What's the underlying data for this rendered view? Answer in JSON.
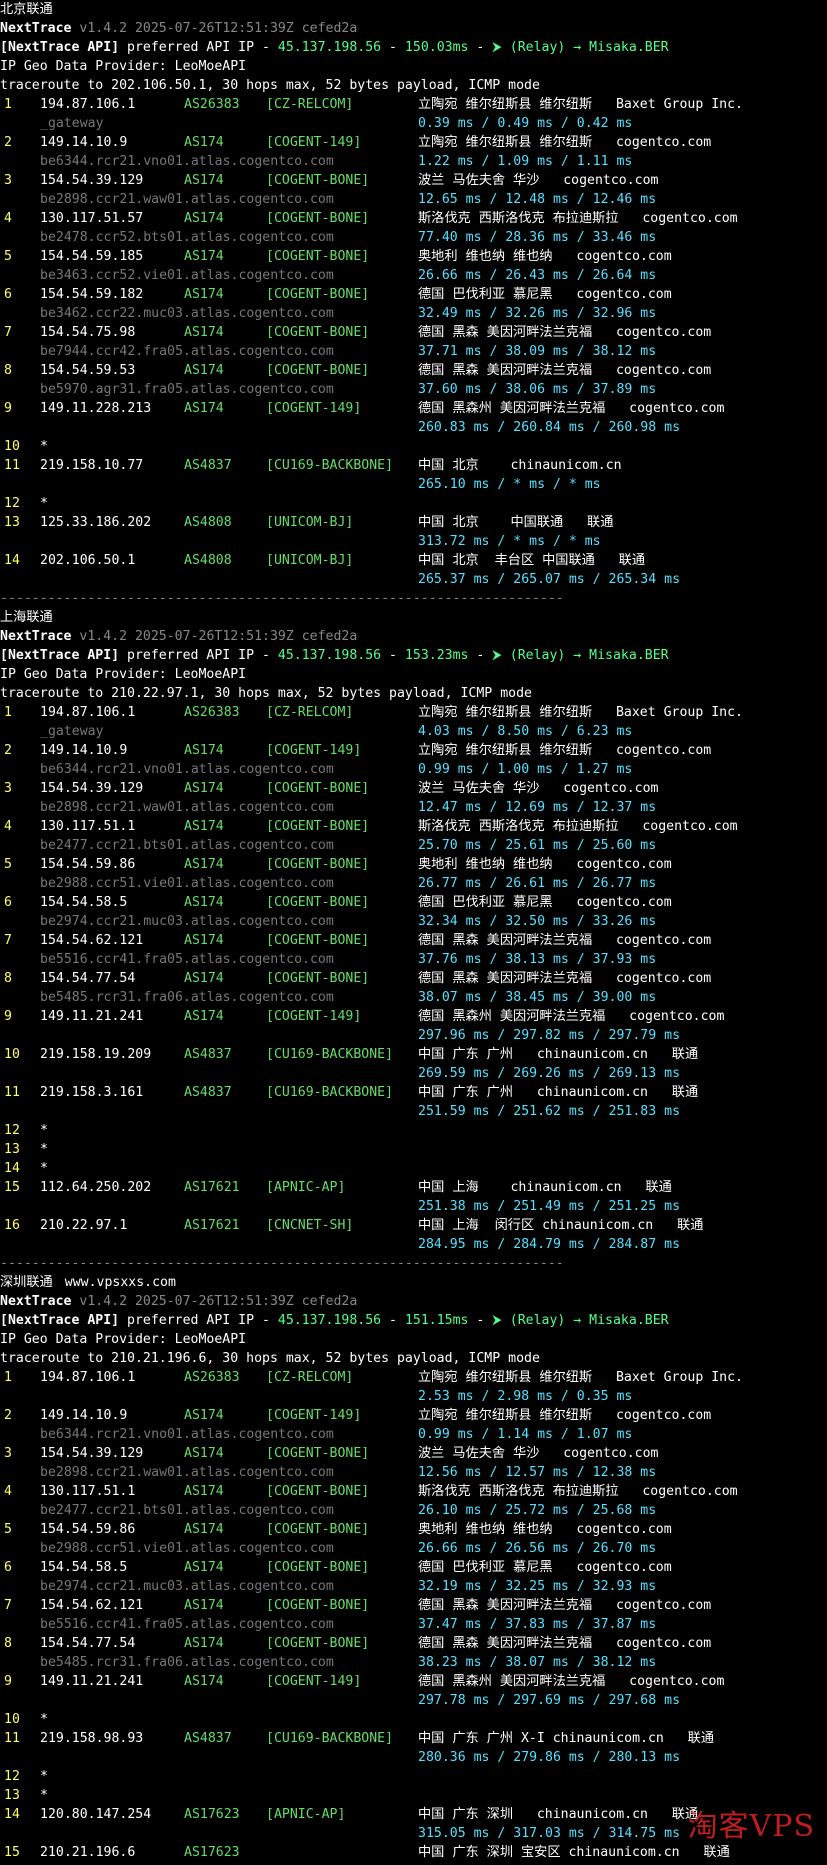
{
  "watermark": "淘客VPS",
  "sections": [
    {
      "title": "北京联通",
      "site": "",
      "version_line": {
        "name": "NextTrace",
        "rest": " v1.4.2 2025-07-26T12:51:39Z cefed2a"
      },
      "api_line": {
        "label": "[NextTrace API]",
        "text": " preferred API IP - ",
        "ip": "45.137.198.56",
        "dash": " - ",
        "latency": "150.03ms",
        "dash2": " - ",
        "relay": "(Relay) → Misaka.BER"
      },
      "provider_line": "IP Geo Data Provider: LeoMoeAPI",
      "traceroute_line": "traceroute to 202.106.50.1, 30 hops max, 52 bytes payload, ICMP mode",
      "hops": [
        {
          "num": "1",
          "ip": "194.87.106.1",
          "as": "AS26383",
          "tag": "[CZ-RELCOM]",
          "geo": "立陶宛 维尔纽斯县 维尔纽斯   Baxet Group Inc.",
          "rdns": "_gateway",
          "rtt": "0.39 ms / 0.49 ms / 0.42 ms"
        },
        {
          "num": "2",
          "ip": "149.14.10.9",
          "as": "AS174",
          "tag": "[COGENT-149]",
          "geo": "立陶宛 维尔纽斯县 维尔纽斯   cogentco.com",
          "rdns": "be6344.rcr21.vno01.atlas.cogentco.com",
          "rtt": "1.22 ms / 1.09 ms / 1.11 ms"
        },
        {
          "num": "3",
          "ip": "154.54.39.129",
          "as": "AS174",
          "tag": "[COGENT-BONE]",
          "geo": "波兰 马佐夫舍 华沙   cogentco.com",
          "rdns": "be2898.ccr21.waw01.atlas.cogentco.com",
          "rtt": "12.65 ms / 12.48 ms / 12.46 ms"
        },
        {
          "num": "4",
          "ip": "130.117.51.57",
          "as": "AS174",
          "tag": "[COGENT-BONE]",
          "geo": "斯洛伐克 西斯洛伐克 布拉迪斯拉   cogentco.com",
          "rdns": "be2478.ccr52.bts01.atlas.cogentco.com",
          "rtt": "77.40 ms / 28.36 ms / 33.46 ms"
        },
        {
          "num": "5",
          "ip": "154.54.59.185",
          "as": "AS174",
          "tag": "[COGENT-BONE]",
          "geo": "奥地利 维也纳 维也纳   cogentco.com",
          "rdns": "be3463.ccr52.vie01.atlas.cogentco.com",
          "rtt": "26.66 ms / 26.43 ms / 26.64 ms"
        },
        {
          "num": "6",
          "ip": "154.54.59.182",
          "as": "AS174",
          "tag": "[COGENT-BONE]",
          "geo": "德国 巴伐利亚 慕尼黑   cogentco.com",
          "rdns": "be3462.ccr22.muc03.atlas.cogentco.com",
          "rtt": "32.49 ms / 32.26 ms / 32.96 ms"
        },
        {
          "num": "7",
          "ip": "154.54.75.98",
          "as": "AS174",
          "tag": "[COGENT-BONE]",
          "geo": "德国 黑森 美因河畔法兰克福   cogentco.com",
          "rdns": "be7944.ccr42.fra05.atlas.cogentco.com",
          "rtt": "37.71 ms / 38.09 ms / 38.12 ms"
        },
        {
          "num": "8",
          "ip": "154.54.59.53",
          "as": "AS174",
          "tag": "[COGENT-BONE]",
          "geo": "德国 黑森 美因河畔法兰克福   cogentco.com",
          "rdns": "be5970.agr31.fra05.atlas.cogentco.com",
          "rtt": "37.60 ms / 38.06 ms / 37.89 ms"
        },
        {
          "num": "9",
          "ip": "149.11.228.213",
          "as": "AS174",
          "tag": "[COGENT-149]",
          "geo": "德国 黑森州 美因河畔法兰克福   cogentco.com",
          "rdns": "",
          "rtt": "260.83 ms / 260.84 ms / 260.98 ms"
        },
        {
          "num": "10",
          "ip": "*",
          "as": "",
          "tag": "",
          "geo": "",
          "rdns": "",
          "rtt": ""
        },
        {
          "num": "11",
          "ip": "219.158.10.77",
          "as": "AS4837",
          "tag": "[CU169-BACKBONE]",
          "geo": "中国 北京    chinaunicom.cn",
          "rdns": "",
          "rtt": "265.10 ms / * ms / * ms"
        },
        {
          "num": "12",
          "ip": "*",
          "as": "",
          "tag": "",
          "geo": "",
          "rdns": "",
          "rtt": ""
        },
        {
          "num": "13",
          "ip": "125.33.186.202",
          "as": "AS4808",
          "tag": "[UNICOM-BJ]",
          "geo": "中国 北京    中国联通   联通",
          "rdns": "",
          "rtt": "313.72 ms / * ms / * ms"
        },
        {
          "num": "14",
          "ip": "202.106.50.1",
          "as": "AS4808",
          "tag": "[UNICOM-BJ]",
          "geo": "中国 北京  丰台区 中国联通   联通",
          "rdns": "",
          "rtt": "265.37 ms / 265.07 ms / 265.34 ms"
        }
      ]
    },
    {
      "title": "上海联通",
      "site": "",
      "version_line": {
        "name": "NextTrace",
        "rest": " v1.4.2 2025-07-26T12:51:39Z cefed2a"
      },
      "api_line": {
        "label": "[NextTrace API]",
        "text": " preferred API IP - ",
        "ip": "45.137.198.56",
        "dash": " - ",
        "latency": "153.23ms",
        "dash2": " - ",
        "relay": "(Relay) → Misaka.BER"
      },
      "provider_line": "IP Geo Data Provider: LeoMoeAPI",
      "traceroute_line": "traceroute to 210.22.97.1, 30 hops max, 52 bytes payload, ICMP mode",
      "hops": [
        {
          "num": "1",
          "ip": "194.87.106.1",
          "as": "AS26383",
          "tag": "[CZ-RELCOM]",
          "geo": "立陶宛 维尔纽斯县 维尔纽斯   Baxet Group Inc.",
          "rdns": "_gateway",
          "rtt": "4.03 ms / 8.50 ms / 6.23 ms"
        },
        {
          "num": "2",
          "ip": "149.14.10.9",
          "as": "AS174",
          "tag": "[COGENT-149]",
          "geo": "立陶宛 维尔纽斯县 维尔纽斯   cogentco.com",
          "rdns": "be6344.rcr21.vno01.atlas.cogentco.com",
          "rtt": "0.99 ms / 1.00 ms / 1.27 ms"
        },
        {
          "num": "3",
          "ip": "154.54.39.129",
          "as": "AS174",
          "tag": "[COGENT-BONE]",
          "geo": "波兰 马佐夫舍 华沙   cogentco.com",
          "rdns": "be2898.ccr21.waw01.atlas.cogentco.com",
          "rtt": "12.47 ms / 12.69 ms / 12.37 ms"
        },
        {
          "num": "4",
          "ip": "130.117.51.1",
          "as": "AS174",
          "tag": "[COGENT-BONE]",
          "geo": "斯洛伐克 西斯洛伐克 布拉迪斯拉   cogentco.com",
          "rdns": "be2477.ccr21.bts01.atlas.cogentco.com",
          "rtt": "25.70 ms / 25.61 ms / 25.60 ms"
        },
        {
          "num": "5",
          "ip": "154.54.59.86",
          "as": "AS174",
          "tag": "[COGENT-BONE]",
          "geo": "奥地利 维也纳 维也纳   cogentco.com",
          "rdns": "be2988.ccr51.vie01.atlas.cogentco.com",
          "rtt": "26.77 ms / 26.61 ms / 26.77 ms"
        },
        {
          "num": "6",
          "ip": "154.54.58.5",
          "as": "AS174",
          "tag": "[COGENT-BONE]",
          "geo": "德国 巴伐利亚 慕尼黑   cogentco.com",
          "rdns": "be2974.ccr21.muc03.atlas.cogentco.com",
          "rtt": "32.34 ms / 32.50 ms / 33.26 ms"
        },
        {
          "num": "7",
          "ip": "154.54.62.121",
          "as": "AS174",
          "tag": "[COGENT-BONE]",
          "geo": "德国 黑森 美因河畔法兰克福   cogentco.com",
          "rdns": "be5516.ccr41.fra05.atlas.cogentco.com",
          "rtt": "37.76 ms / 38.13 ms / 37.93 ms"
        },
        {
          "num": "8",
          "ip": "154.54.77.54",
          "as": "AS174",
          "tag": "[COGENT-BONE]",
          "geo": "德国 黑森 美因河畔法兰克福   cogentco.com",
          "rdns": "be5485.rcr31.fra06.atlas.cogentco.com",
          "rtt": "38.07 ms / 38.45 ms / 39.00 ms"
        },
        {
          "num": "9",
          "ip": "149.11.21.241",
          "as": "AS174",
          "tag": "[COGENT-149]",
          "geo": "德国 黑森州 美因河畔法兰克福   cogentco.com",
          "rdns": "",
          "rtt": "297.96 ms / 297.82 ms / 297.79 ms"
        },
        {
          "num": "10",
          "ip": "219.158.19.209",
          "as": "AS4837",
          "tag": "[CU169-BACKBONE]",
          "geo": "中国 广东 广州   chinaunicom.cn   联通",
          "rdns": "",
          "rtt": "269.59 ms / 269.26 ms / 269.13 ms"
        },
        {
          "num": "11",
          "ip": "219.158.3.161",
          "as": "AS4837",
          "tag": "[CU169-BACKBONE]",
          "geo": "中国 广东 广州   chinaunicom.cn   联通",
          "rdns": "",
          "rtt": "251.59 ms / 251.62 ms / 251.83 ms"
        },
        {
          "num": "12",
          "ip": "*",
          "as": "",
          "tag": "",
          "geo": "",
          "rdns": "",
          "rtt": ""
        },
        {
          "num": "13",
          "ip": "*",
          "as": "",
          "tag": "",
          "geo": "",
          "rdns": "",
          "rtt": ""
        },
        {
          "num": "14",
          "ip": "*",
          "as": "",
          "tag": "",
          "geo": "",
          "rdns": "",
          "rtt": ""
        },
        {
          "num": "15",
          "ip": "112.64.250.202",
          "as": "AS17621",
          "tag": "[APNIC-AP]",
          "geo": "中国 上海    chinaunicom.cn   联通",
          "rdns": "",
          "rtt": "251.38 ms / 251.49 ms / 251.25 ms"
        },
        {
          "num": "16",
          "ip": "210.22.97.1",
          "as": "AS17621",
          "tag": "[CNCNET-SH]",
          "geo": "中国 上海  闵行区 chinaunicom.cn   联通",
          "rdns": "",
          "rtt": "284.95 ms / 284.79 ms / 284.87 ms"
        }
      ]
    },
    {
      "title": "深圳联通",
      "site": "www.vpsxxs.com",
      "version_line": {
        "name": "NextTrace",
        "rest": " v1.4.2 2025-07-26T12:51:39Z cefed2a"
      },
      "api_line": {
        "label": "[NextTrace API]",
        "text": " preferred API IP - ",
        "ip": "45.137.198.56",
        "dash": " - ",
        "latency": "151.15ms",
        "dash2": " - ",
        "relay": "(Relay) → Misaka.BER"
      },
      "provider_line": "IP Geo Data Provider: LeoMoeAPI",
      "traceroute_line": "traceroute to 210.21.196.6, 30 hops max, 52 bytes payload, ICMP mode",
      "hops": [
        {
          "num": "1",
          "ip": "194.87.106.1",
          "as": "AS26383",
          "tag": "[CZ-RELCOM]",
          "geo": "立陶宛 维尔纽斯县 维尔纽斯   Baxet Group Inc.",
          "rdns": "",
          "rtt": "2.53 ms / 2.98 ms / 0.35 ms"
        },
        {
          "num": "2",
          "ip": "149.14.10.9",
          "as": "AS174",
          "tag": "[COGENT-149]",
          "geo": "立陶宛 维尔纽斯县 维尔纽斯   cogentco.com",
          "rdns": "be6344.rcr21.vno01.atlas.cogentco.com",
          "rtt": "0.99 ms / 1.14 ms / 1.07 ms"
        },
        {
          "num": "3",
          "ip": "154.54.39.129",
          "as": "AS174",
          "tag": "[COGENT-BONE]",
          "geo": "波兰 马佐夫舍 华沙   cogentco.com",
          "rdns": "be2898.ccr21.waw01.atlas.cogentco.com",
          "rtt": "12.56 ms / 12.57 ms / 12.38 ms"
        },
        {
          "num": "4",
          "ip": "130.117.51.1",
          "as": "AS174",
          "tag": "[COGENT-BONE]",
          "geo": "斯洛伐克 西斯洛伐克 布拉迪斯拉   cogentco.com",
          "rdns": "be2477.ccr21.bts01.atlas.cogentco.com",
          "rtt": "26.10 ms / 25.72 ms / 25.68 ms"
        },
        {
          "num": "5",
          "ip": "154.54.59.86",
          "as": "AS174",
          "tag": "[COGENT-BONE]",
          "geo": "奥地利 维也纳 维也纳   cogentco.com",
          "rdns": "be2988.ccr51.vie01.atlas.cogentco.com",
          "rtt": "26.66 ms / 26.56 ms / 26.70 ms"
        },
        {
          "num": "6",
          "ip": "154.54.58.5",
          "as": "AS174",
          "tag": "[COGENT-BONE]",
          "geo": "德国 巴伐利亚 慕尼黑   cogentco.com",
          "rdns": "be2974.ccr21.muc03.atlas.cogentco.com",
          "rtt": "32.19 ms / 32.25 ms / 32.93 ms"
        },
        {
          "num": "7",
          "ip": "154.54.62.121",
          "as": "AS174",
          "tag": "[COGENT-BONE]",
          "geo": "德国 黑森 美因河畔法兰克福   cogentco.com",
          "rdns": "be5516.ccr41.fra05.atlas.cogentco.com",
          "rtt": "37.47 ms / 37.83 ms / 37.87 ms"
        },
        {
          "num": "8",
          "ip": "154.54.77.54",
          "as": "AS174",
          "tag": "[COGENT-BONE]",
          "geo": "德国 黑森 美因河畔法兰克福   cogentco.com",
          "rdns": "be5485.rcr31.fra06.atlas.cogentco.com",
          "rtt": "38.23 ms / 38.07 ms / 38.12 ms"
        },
        {
          "num": "9",
          "ip": "149.11.21.241",
          "as": "AS174",
          "tag": "[COGENT-149]",
          "geo": "德国 黑森州 美因河畔法兰克福   cogentco.com",
          "rdns": "",
          "rtt": "297.78 ms / 297.69 ms / 297.68 ms"
        },
        {
          "num": "10",
          "ip": "*",
          "as": "",
          "tag": "",
          "geo": "",
          "rdns": "",
          "rtt": ""
        },
        {
          "num": "11",
          "ip": "219.158.98.93",
          "as": "AS4837",
          "tag": "[CU169-BACKBONE]",
          "geo": "中国 广东 广州 X-I chinaunicom.cn   联通",
          "rdns": "",
          "rtt": "280.36 ms / 279.86 ms / 280.13 ms"
        },
        {
          "num": "12",
          "ip": "*",
          "as": "",
          "tag": "",
          "geo": "",
          "rdns": "",
          "rtt": ""
        },
        {
          "num": "13",
          "ip": "*",
          "as": "",
          "tag": "",
          "geo": "",
          "rdns": "",
          "rtt": ""
        },
        {
          "num": "14",
          "ip": "120.80.147.254",
          "as": "AS17623",
          "tag": "[APNIC-AP]",
          "geo": "中国 广东 深圳   chinaunicom.cn   联通",
          "rdns": "",
          "rtt": "315.05 ms / 317.03 ms / 314.75 ms"
        },
        {
          "num": "15",
          "ip": "210.21.196.6",
          "as": "AS17623",
          "tag": "",
          "geo": "中国 广东 深圳 宝安区 chinaunicom.cn   联通",
          "rdns": "",
          "rtt": ""
        }
      ]
    }
  ],
  "separator": "-----------------------------------------------------------------------"
}
